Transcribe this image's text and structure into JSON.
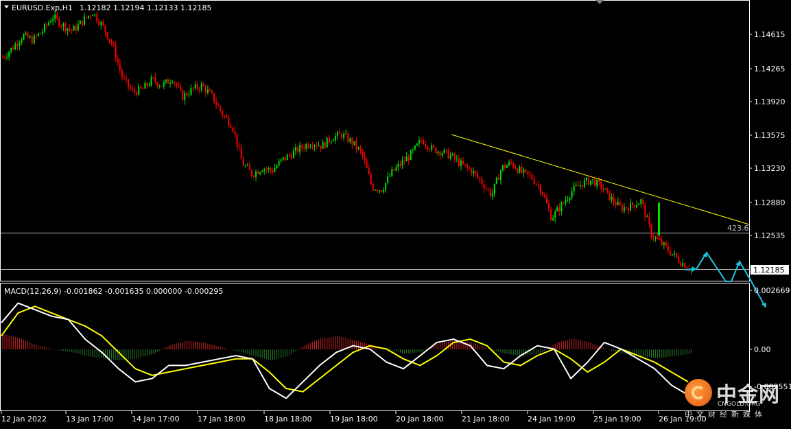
{
  "header": {
    "symbol_label": "EURUSD.Exp,H1",
    "ohlc_label": "1.12182 1.12194 1.12133 1.12185"
  },
  "macd_header": {
    "label": "MACD(12,26,9) -0.001862 -0.001635 0.000000 -0.000295"
  },
  "colors": {
    "background": "#000000",
    "bull_candle": "#00e000",
    "bear_candle": "#ff0000",
    "trendline": "#ffff00",
    "level_line": "#c0c0c0",
    "forecast_arrow": "#1ec8e6",
    "macd_line": "#ffffff",
    "signal_line": "#ffff00",
    "hist_positive": "#cc2222",
    "hist_negative": "#2a7a2a"
  },
  "price_axis": {
    "ticks": [
      "1.14615",
      "1.14265",
      "1.13920",
      "1.13575",
      "1.13230",
      "1.12880",
      "1.12535"
    ],
    "current_price_label": "1.12185"
  },
  "macd_axis": {
    "ticks": [
      "0.002669",
      "0.00",
      "-0.002551"
    ]
  },
  "time_axis": {
    "labels": [
      "12 Jan 2022",
      "13 Jan 17:00",
      "14 Jan 17:00",
      "17 Jan 18:00",
      "18 Jan 18:00",
      "19 Jan 18:00",
      "20 Jan 18:00",
      "21 Jan 18:00",
      "24 Jan 19:00",
      "25 Jan 19:00",
      "26 Jan 19:00"
    ]
  },
  "annotations": {
    "fib_level_label": "423.6"
  },
  "watermark": {
    "brand_cn": "中金网",
    "site": "CNGOLD.ORG",
    "tagline": "中文财经新媒体"
  },
  "chart_data": [
    {
      "type": "candlestick",
      "title": "EURUSD.Exp,H1",
      "ylim": [
        1.1212,
        1.1488
      ],
      "x": [
        "12 Jan 2022",
        "13 Jan 17:00",
        "14 Jan 17:00",
        "17 Jan 18:00",
        "18 Jan 18:00",
        "19 Jan 18:00",
        "20 Jan 18:00",
        "21 Jan 18:00",
        "24 Jan 19:00",
        "25 Jan 19:00",
        "26 Jan 19:00"
      ],
      "close_path": [
        1.1442,
        1.1452,
        1.1465,
        1.146,
        1.147,
        1.1485,
        1.1476,
        1.147,
        1.148,
        1.149,
        1.1475,
        1.1455,
        1.142,
        1.1405,
        1.1408,
        1.1418,
        1.1412,
        1.142,
        1.14,
        1.1408,
        1.1412,
        1.14,
        1.1382,
        1.137,
        1.133,
        1.1318,
        1.1325,
        1.1322,
        1.1333,
        1.134,
        1.1347,
        1.1352,
        1.1348,
        1.1357,
        1.136,
        1.1352,
        1.134,
        1.1305,
        1.1302,
        1.132,
        1.133,
        1.134,
        1.1355,
        1.1345,
        1.1342,
        1.1337,
        1.1328,
        1.1322,
        1.131,
        1.1296,
        1.1325,
        1.133,
        1.132,
        1.1315,
        1.1302,
        1.1272,
        1.1285,
        1.13,
        1.1308,
        1.1312,
        1.1305,
        1.1292,
        1.1282,
        1.1285,
        1.129,
        1.1255,
        1.1245,
        1.1235,
        1.1225,
        1.1218
      ],
      "horizontal_levels": [
        1.12568,
        1.12185
      ],
      "trendline": {
        "from": [
          1.13625
        ],
        "to": [
          1.12618
        ]
      },
      "current_price": 1.12185
    },
    {
      "type": "macd",
      "title": "MACD(12,26,9)",
      "values": {
        "macd": -0.001862,
        "signal": -0.001635,
        "zero": 0.0,
        "histogram": -0.000295
      },
      "ylim": [
        -0.002551,
        0.002669
      ],
      "macd_path": [
        0.0016,
        0.0028,
        0.0024,
        0.002,
        0.0018,
        0.0006,
        -0.0002,
        -0.0012,
        -0.002,
        -0.0018,
        -0.001,
        -0.001,
        -0.0008,
        -0.0006,
        -0.0004,
        -0.0006,
        -0.0024,
        -0.003,
        -0.002,
        -0.001,
        -0.0002,
        0.0002,
        0.0,
        -0.0008,
        -0.0012,
        -0.0004,
        0.0004,
        0.0006,
        0.0002,
        -0.001,
        -0.0012,
        -0.0004,
        0.0002,
        0.0,
        -0.0018,
        -0.0008,
        0.0004,
        0.0,
        -0.0006,
        -0.0012,
        -0.0022,
        -0.0028
      ],
      "signal_path": [
        0.0008,
        0.0022,
        0.0026,
        0.0022,
        0.0018,
        0.0014,
        0.0008,
        -0.0002,
        -0.0012,
        -0.0016,
        -0.0014,
        -0.0012,
        -0.001,
        -0.0008,
        -0.0006,
        -0.0006,
        -0.0014,
        -0.0024,
        -0.0026,
        -0.0018,
        -0.001,
        -0.0002,
        0.0002,
        0.0,
        -0.0006,
        -0.001,
        -0.0004,
        0.0004,
        0.0006,
        0.0002,
        -0.0008,
        -0.001,
        -0.0004,
        0.0,
        -0.0006,
        -0.0014,
        -0.0008,
        0.0,
        -0.0004,
        -0.0008,
        -0.0014,
        -0.002
      ],
      "histogram_path": [
        0.0014,
        0.001,
        0.0004,
        0.0,
        -0.0002,
        -0.0006,
        -0.0008,
        -0.001,
        -0.0008,
        -0.0004,
        0.0004,
        0.0008,
        0.0006,
        0.0002,
        -0.0002,
        -0.0006,
        -0.001,
        -0.0006,
        0.0004,
        0.001,
        0.0012,
        0.0008,
        0.0004,
        0.0,
        -0.0004,
        -0.0002,
        0.0006,
        0.0008,
        0.0006,
        0.0,
        -0.0004,
        -0.0006,
        -0.0004,
        0.0006,
        0.001,
        0.0006,
        0.0,
        -0.0004,
        -0.0006,
        -0.0008,
        -0.0006,
        -0.0004
      ]
    }
  ]
}
